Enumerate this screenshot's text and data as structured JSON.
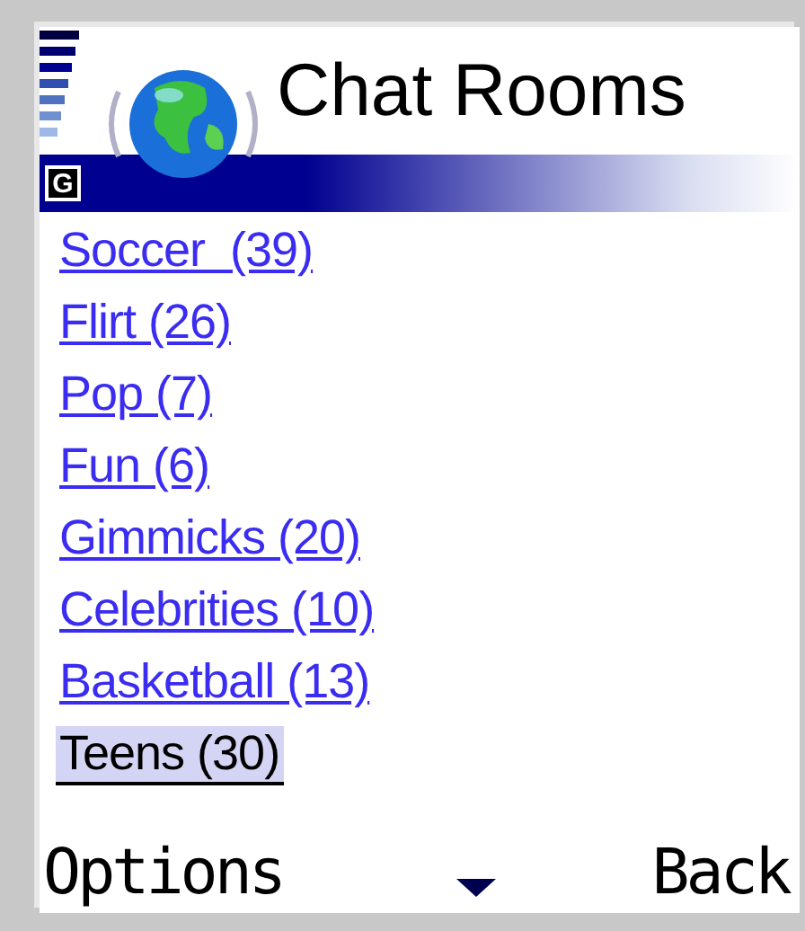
{
  "header": {
    "title": "Chat Rooms",
    "badge": "G"
  },
  "rooms": [
    {
      "label": "Soccer  (39)",
      "selected": false
    },
    {
      "label": "Flirt (26)",
      "selected": false
    },
    {
      "label": "Pop (7)",
      "selected": false
    },
    {
      "label": "Fun (6)",
      "selected": false
    },
    {
      "label": "Gimmicks (20)",
      "selected": false
    },
    {
      "label": "Celebrities (10)",
      "selected": false
    },
    {
      "label": "Basketball (13)",
      "selected": false
    },
    {
      "label": "Teens (30)",
      "selected": true
    }
  ],
  "softkeys": {
    "left": "Options",
    "right": "Back"
  }
}
